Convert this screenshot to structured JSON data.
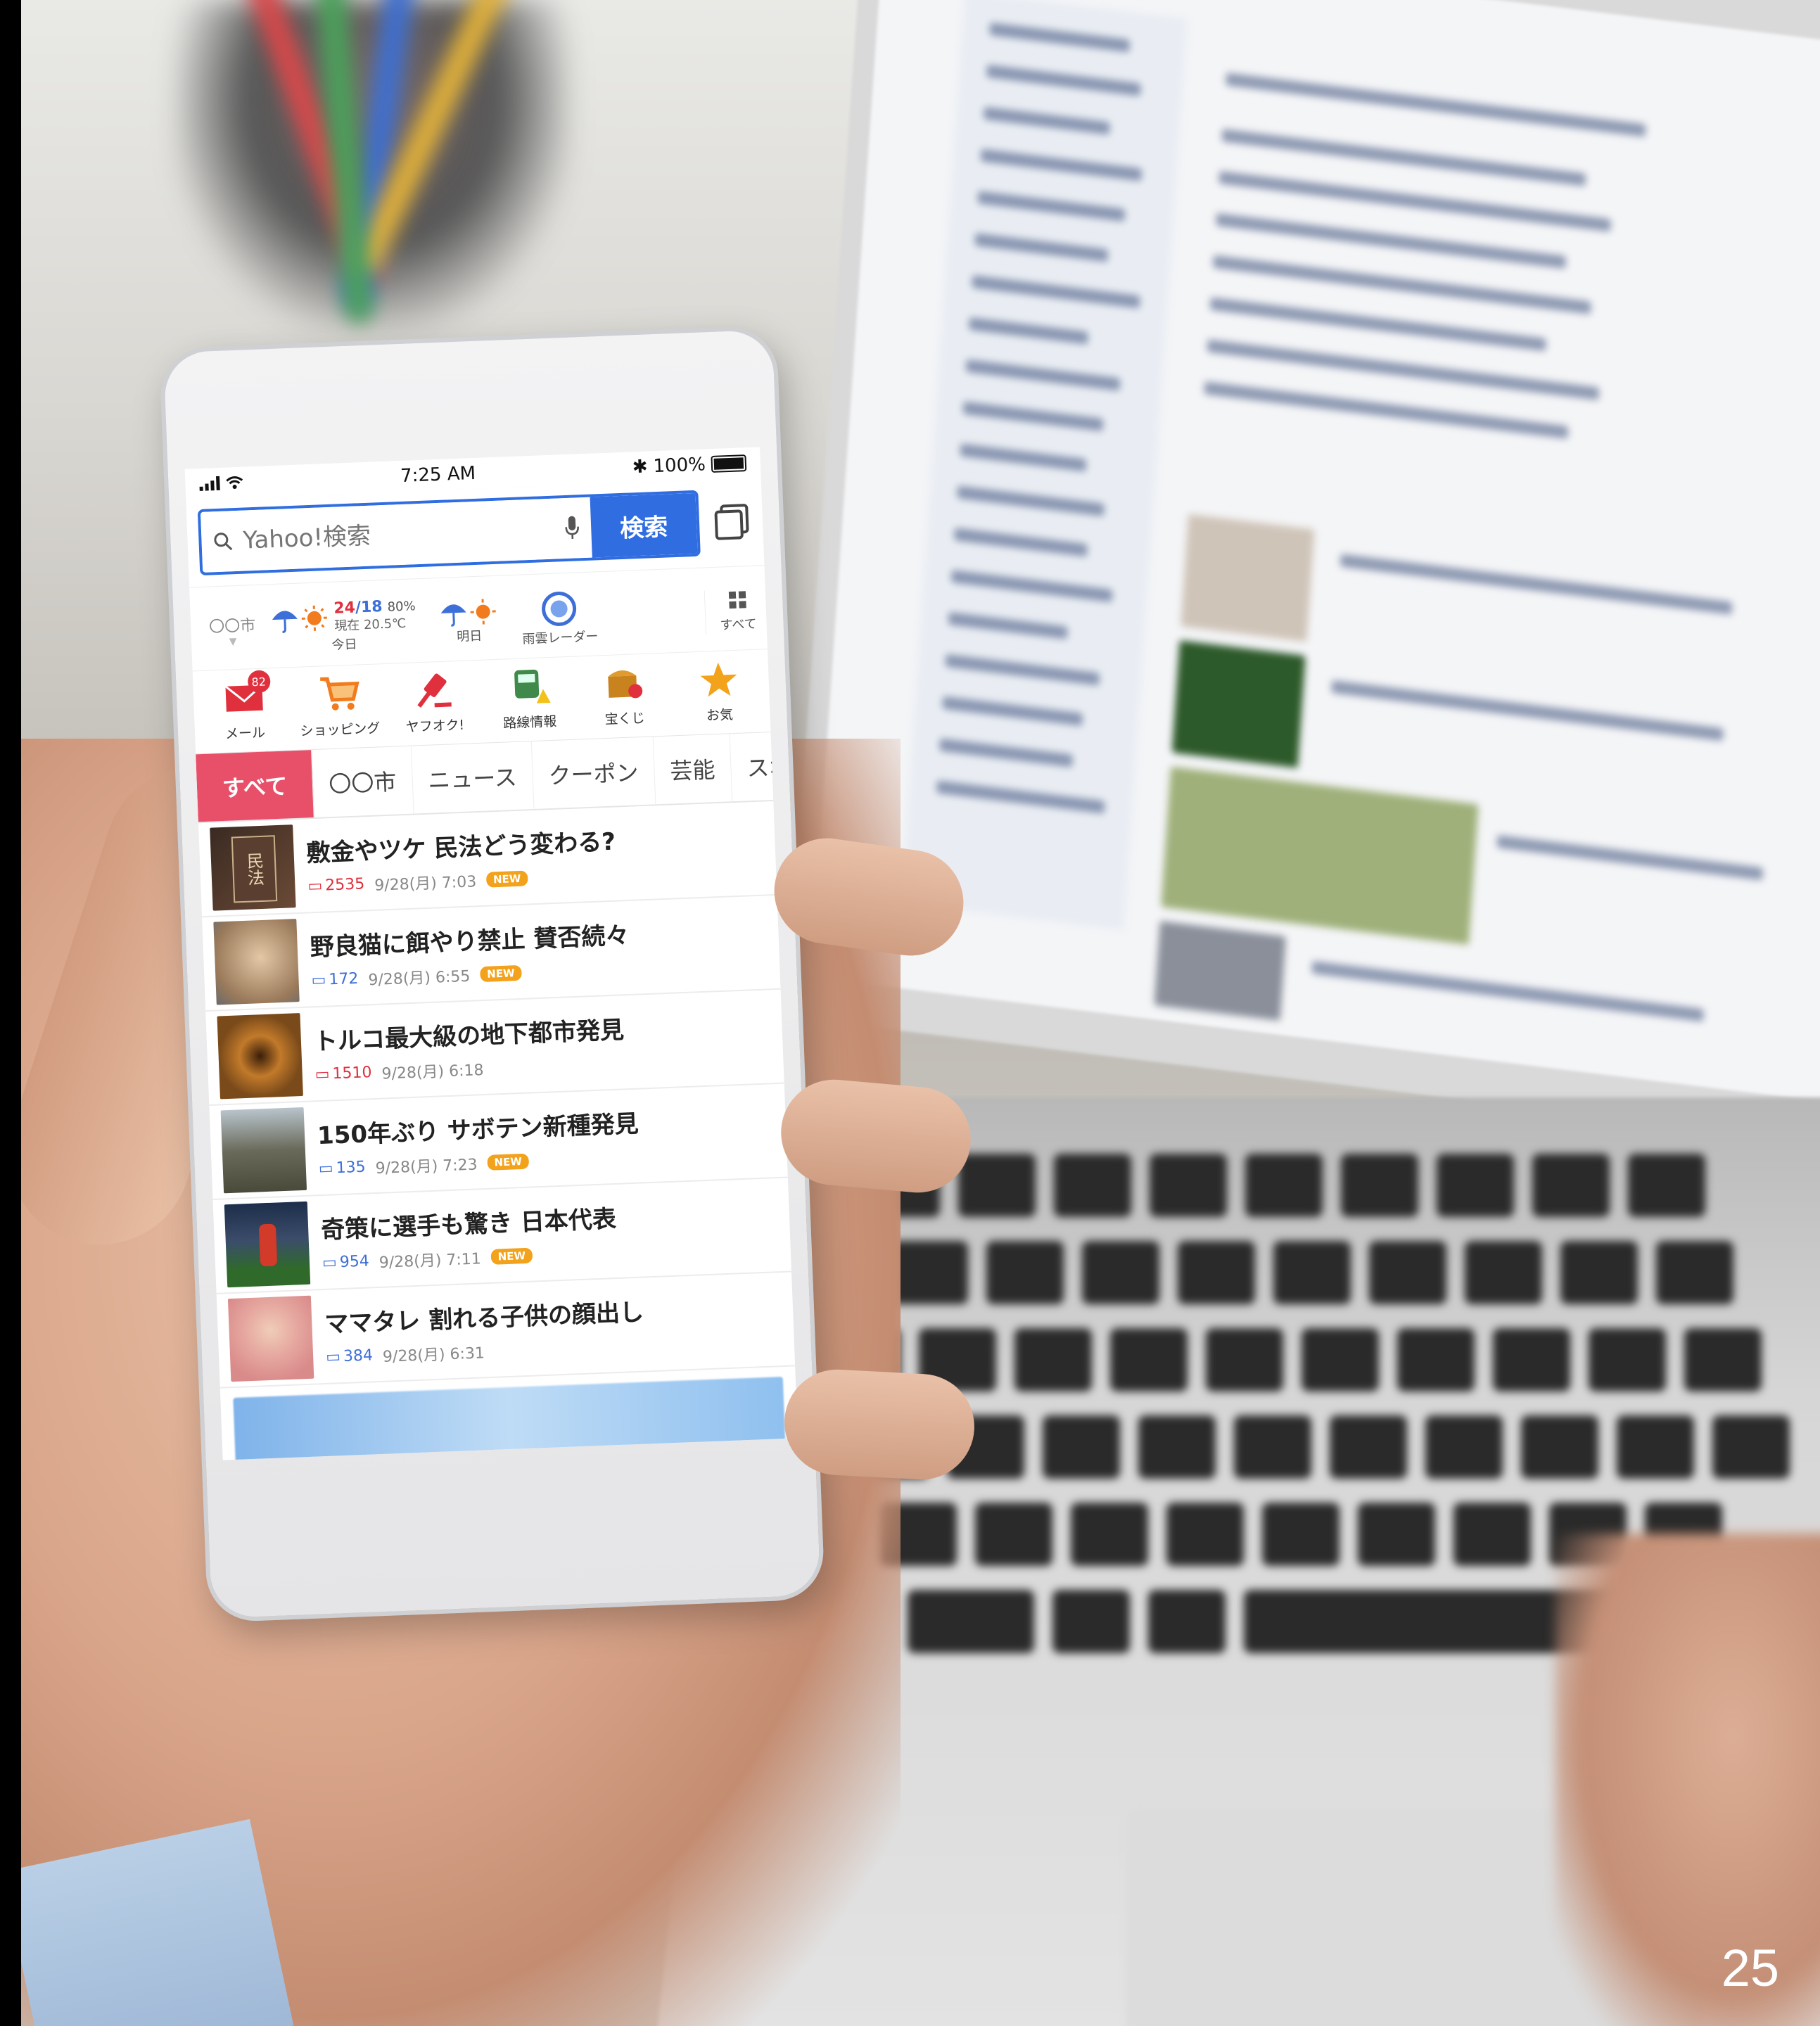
{
  "page": {
    "number": "25"
  },
  "status_bar": {
    "time": "7:25 AM",
    "battery": "100%"
  },
  "search": {
    "placeholder": "Yahoo!検索",
    "button_label": "検索"
  },
  "weather": {
    "city": "〇〇市",
    "today": {
      "label": "今日",
      "high": "24",
      "low": "/18",
      "rain_chance": "80%",
      "current": "現在 20.5℃"
    },
    "tomorrow": {
      "label": "明日"
    },
    "radar": {
      "label": "雨雲レーダー"
    },
    "all": {
      "label": "すべて"
    }
  },
  "services": [
    {
      "label": "メール",
      "badge": "82"
    },
    {
      "label": "ショッピング"
    },
    {
      "label": "ヤフオク!"
    },
    {
      "label": "路線情報"
    },
    {
      "label": "宝くじ"
    },
    {
      "label": "お気"
    }
  ],
  "category_tabs": [
    {
      "label": "すべて"
    },
    {
      "label": "〇〇市"
    },
    {
      "label": "ニュース"
    },
    {
      "label": "クーポン"
    },
    {
      "label": "芸能"
    },
    {
      "label": "スポー"
    }
  ],
  "news": [
    {
      "title": "敷金やツケ 民法どう変わる?",
      "comments": "2535",
      "date": "9/28(月) 7:03",
      "badge": "NEW",
      "hot": true
    },
    {
      "title": "野良猫に餌やり禁止 賛否続々",
      "comments": "172",
      "date": "9/28(月) 6:55",
      "badge": "NEW",
      "hot": false
    },
    {
      "title": "トルコ最大級の地下都市発見",
      "comments": "1510",
      "date": "9/28(月) 6:18",
      "badge": "",
      "hot": true
    },
    {
      "title": "150年ぶり サボテン新種発見",
      "comments": "135",
      "date": "9/28(月) 7:23",
      "badge": "NEW",
      "hot": false
    },
    {
      "title": "奇策に選手も驚き 日本代表",
      "comments": "954",
      "date": "9/28(月) 7:11",
      "badge": "NEW",
      "hot": false
    },
    {
      "title": "ママタレ 割れる子供の顔出し",
      "comments": "384",
      "date": "9/28(月) 6:31",
      "badge": "",
      "hot": false
    }
  ],
  "colors": {
    "accent_blue": "#2f6de1",
    "tab_active": "#e8506a",
    "new_badge": "#f2a21b",
    "hot_comment": "#e0303e"
  },
  "thumb_icon": "民法"
}
